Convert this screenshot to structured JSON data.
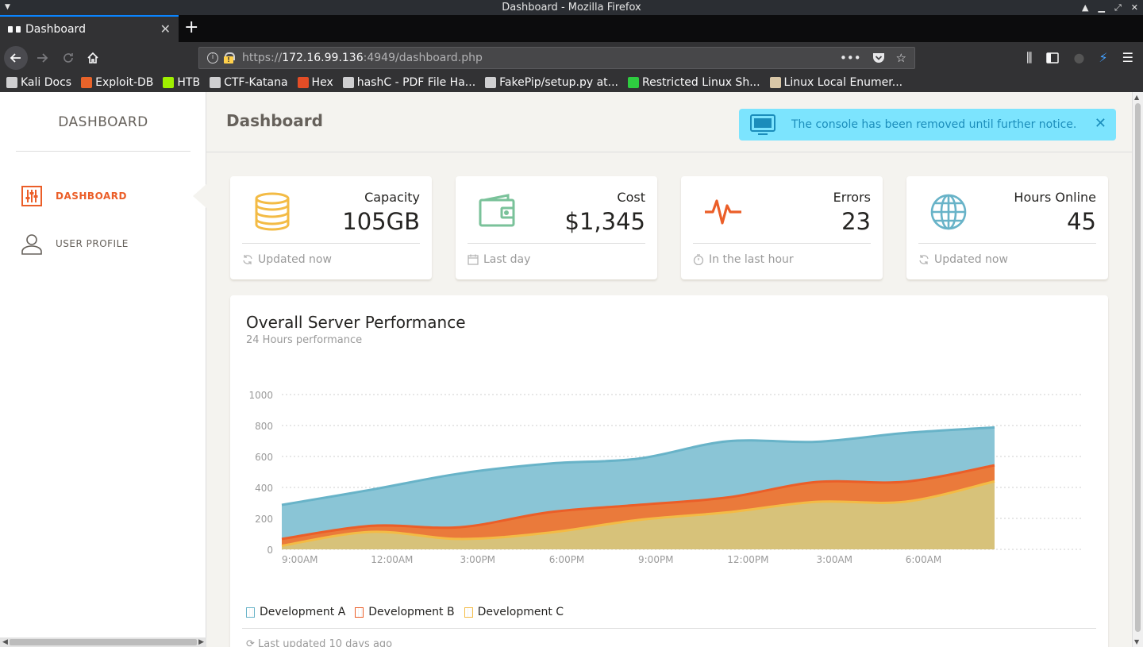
{
  "window": {
    "title": "Dashboard - Mozilla Firefox"
  },
  "browser": {
    "tab_title": "Dashboard",
    "url_prefix": "https://",
    "url_host": "172.16.99.136",
    "url_rest": ":4949/dashboard.php",
    "bookmarks": [
      {
        "label": "Kali Docs",
        "icon": "kali-icon",
        "color": "#cfcfd1"
      },
      {
        "label": "Exploit-DB",
        "icon": "exploit-db-icon",
        "color": "#e8632a"
      },
      {
        "label": "HTB",
        "icon": "htb-icon",
        "color": "#9fef00"
      },
      {
        "label": "CTF-Katana",
        "icon": "globe-icon",
        "color": "#cfcfd1"
      },
      {
        "label": "Hex",
        "icon": "html5-icon",
        "color": "#e44d26"
      },
      {
        "label": "hashC - PDF File Ha...",
        "icon": "globe-icon",
        "color": "#cfcfd1"
      },
      {
        "label": "FakePip/setup.py at...",
        "icon": "github-icon",
        "color": "#cfcfd1"
      },
      {
        "label": "Restricted Linux Sh...",
        "icon": "terminal-icon",
        "color": "#2ecc40"
      },
      {
        "label": "Linux Local Enumer...",
        "icon": "cup-icon",
        "color": "#d9c7a7"
      }
    ]
  },
  "sidebar": {
    "title": "DASHBOARD",
    "items": [
      {
        "label": "DASHBOARD",
        "icon": "sliders-icon"
      },
      {
        "label": "USER PROFILE",
        "icon": "user-icon"
      }
    ]
  },
  "header": {
    "title": "Dashboard",
    "alert": "The console has been removed until further notice."
  },
  "stats": [
    {
      "label": "Capacity",
      "value": "105GB",
      "footer": "Updated now",
      "icon": "database-icon",
      "footer_icon": "refresh-icon",
      "color": "#f3bb45"
    },
    {
      "label": "Cost",
      "value": "$1,345",
      "footer": "Last day",
      "icon": "wallet-icon",
      "footer_icon": "calendar-icon",
      "color": "#7ac29a"
    },
    {
      "label": "Errors",
      "value": "23",
      "footer": "In the last hour",
      "icon": "pulse-icon",
      "footer_icon": "timer-icon",
      "color": "#eb5e28"
    },
    {
      "label": "Hours Online",
      "value": "45",
      "footer": "Updated now",
      "icon": "globe-icon",
      "footer_icon": "refresh-icon",
      "color": "#68b3c8"
    }
  ],
  "chart": {
    "title": "Overall Server Performance",
    "subtitle": "24 Hours performance",
    "footer": "Last updated 10 days ago"
  },
  "chart_data": {
    "type": "area",
    "x": [
      "9:00AM",
      "12:00AM",
      "3:00PM",
      "6:00PM",
      "9:00PM",
      "12:00PM",
      "3:00AM",
      "6:00AM",
      ""
    ],
    "x_tick_labels": [
      "9:00AM",
      "12:00AM",
      "3:00PM",
      "6:00PM",
      "9:00PM",
      "12:00PM",
      "3:00AM",
      "6:00AM"
    ],
    "series": [
      {
        "name": "Development A",
        "values": [
          287,
          385,
          490,
          554,
          586,
          698,
          695,
          752,
          788
        ],
        "color": "#68b3c8",
        "fill": "#8ac5d6"
      },
      {
        "name": "Development B",
        "values": [
          67,
          152,
          143,
          240,
          287,
          335,
          435,
          437,
          543
        ],
        "color": "#eb5e28",
        "fill": "#ea7a3b"
      },
      {
        "name": "Development C",
        "values": [
          23,
          113,
          67,
          108,
          190,
          239,
          307,
          308,
          439
        ],
        "color": "#f3bb45",
        "fill": "#d7c27a"
      }
    ],
    "ylim": [
      0,
      1000
    ],
    "yticks": [
      0,
      200,
      400,
      600,
      800,
      1000
    ],
    "grid": true,
    "legend": "bottom-left"
  }
}
